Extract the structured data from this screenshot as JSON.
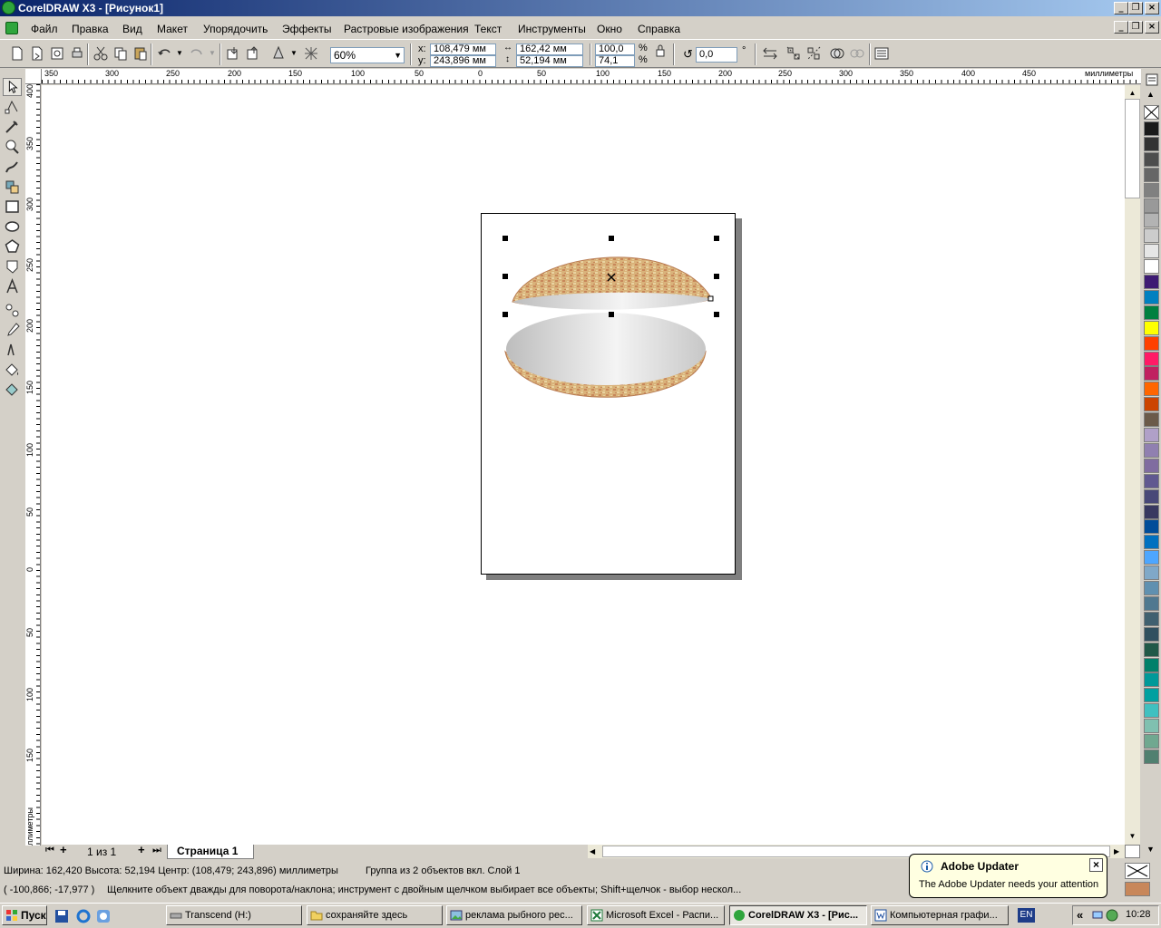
{
  "window": {
    "title": "CorelDRAW X3 - [Рисунок1]"
  },
  "menu": [
    "Файл",
    "Правка",
    "Вид",
    "Макет",
    "Упорядочить",
    "Эффекты",
    "Растровые изображения",
    "Текст",
    "Инструменты",
    "Окно",
    "Справка"
  ],
  "toolbar": {
    "zoom": "60%",
    "x_label": "x:",
    "y_label": "y:",
    "x_value": "108,479 мм",
    "y_value": "243,896 мм",
    "width_value": "162,42 мм",
    "height_value": "52,194 мм",
    "scale_x": "100,0",
    "scale_y": "74,1",
    "percent1": "%",
    "percent2": "%",
    "angle": "0,0",
    "degree": "°"
  },
  "ruler": {
    "h_ticks": [
      "350",
      "300",
      "250",
      "200",
      "150",
      "100",
      "50",
      "0",
      "50",
      "100",
      "150",
      "200",
      "250",
      "300",
      "350",
      "400",
      "450"
    ],
    "h_units": "миллиметры",
    "v_ticks": [
      "400",
      "350",
      "300",
      "250",
      "200",
      "150",
      "100",
      "50",
      "0",
      "50",
      "100",
      "150"
    ],
    "v_units": "миллиметры"
  },
  "pages": {
    "counter": "1 из 1",
    "tab": "Страница 1"
  },
  "status": {
    "dims": "Ширина: 162,420  Высота: 52,194  Центр: (108,479; 243,896)  миллиметры",
    "selection": "Группа из 2 объектов вкл. Слой 1",
    "cursor": "( -100,866; -17,977 )",
    "hint": "Щелкните объект дважды для поворота/наклона; инструмент с двойным щелчком выбирает все объекты; Shift+щелчок - выбор нескол..."
  },
  "balloon": {
    "title": "Adobe Updater",
    "message": "The Adobe Updater needs your attention"
  },
  "taskbar": {
    "start": "Пуск",
    "tasks": [
      "Transcend (H:)",
      "сохраняйте здесь",
      "реклама рыбного рес...",
      "Microsoft Excel - Распи...",
      "CorelDRAW X3 - [Рис...",
      "Компьютерная графи..."
    ],
    "lang": "EN",
    "clock": "10:28",
    "chevron": "«"
  },
  "colors": {
    "palette": [
      "#1a1a1a",
      "#333333",
      "#4d4d4d",
      "#666666",
      "#808080",
      "#999999",
      "#b3b3b3",
      "#cccccc",
      "#e6e6e6",
      "#ffffff",
      "#3d1a73",
      "#0080c0",
      "#008040",
      "#ffff00",
      "#ff4000",
      "#ff1a66",
      "#c02060",
      "#ff6600",
      "#cc4400",
      "#6b5a4a",
      "#b0a0c8",
      "#9080b0",
      "#806ca0",
      "#605890",
      "#484878",
      "#383860",
      "#004c99",
      "#0070c0",
      "#4da6ff",
      "#80a8c8",
      "#6090b0",
      "#507890",
      "#406070",
      "#305060",
      "#205848",
      "#00806a",
      "#009999",
      "#00a0a0",
      "#40c0c0",
      "#80c0b0",
      "#70a890",
      "#508070"
    ],
    "fill_swatch": "#c8875a"
  }
}
